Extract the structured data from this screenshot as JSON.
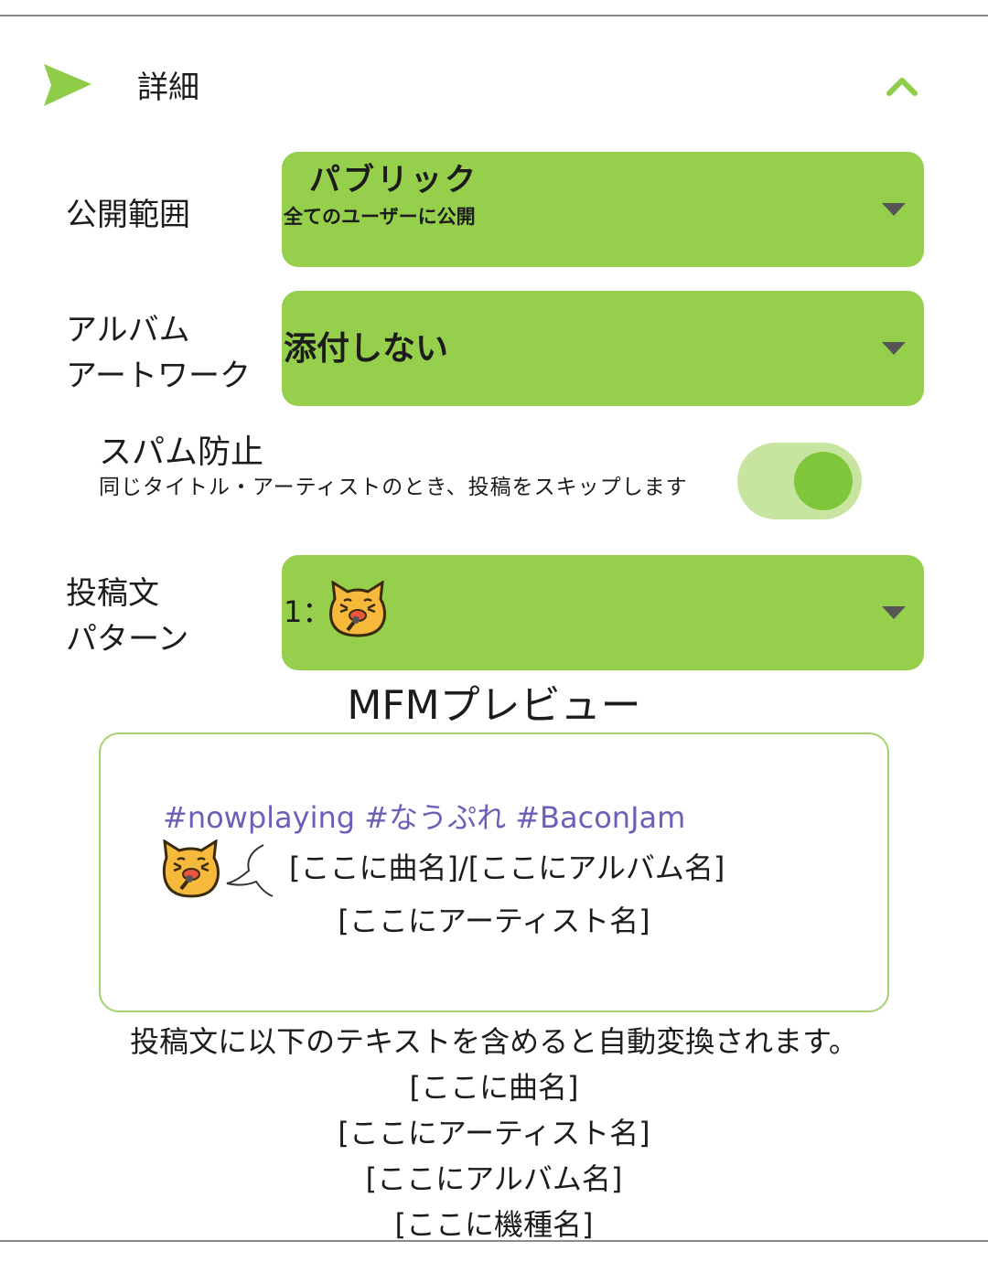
{
  "section": {
    "title": "詳細",
    "icon": "send-icon",
    "collapse_icon": "chevron-up-icon"
  },
  "colors": {
    "accent": "#96cf4c",
    "toggle_track": "#c7e5a0",
    "toggle_knob": "#7fc63a",
    "hashtag": "#6c5fb8"
  },
  "visibility": {
    "label": "公開範囲",
    "value": "パブリック",
    "description": "全てのユーザーに公開"
  },
  "album_artwork": {
    "label_line1": "アルバム",
    "label_line2": "アートワーク",
    "value": "添付しない"
  },
  "spam_prevention": {
    "title": "スパム防止",
    "description": "同じタイトル・アーティストのとき、投稿をスキップします",
    "enabled": true
  },
  "post_pattern": {
    "label_line1": "投稿文",
    "label_line2": "パターン",
    "value_prefix": "1："
  },
  "mfm_preview": {
    "title": "MFMプレビュー",
    "hashtags": "#nowplaying #なうぷれ #BaconJam",
    "line1": "[ここに曲名]/[ここにアルバム名]",
    "line2": "[ここにアーティスト名]"
  },
  "help": {
    "intro": "投稿文に以下のテキストを含めると自動変換されます。",
    "placeholders": [
      "[ここに曲名]",
      "[ここにアーティスト名]",
      "[ここにアルバム名]",
      "[ここに機種名]"
    ]
  }
}
